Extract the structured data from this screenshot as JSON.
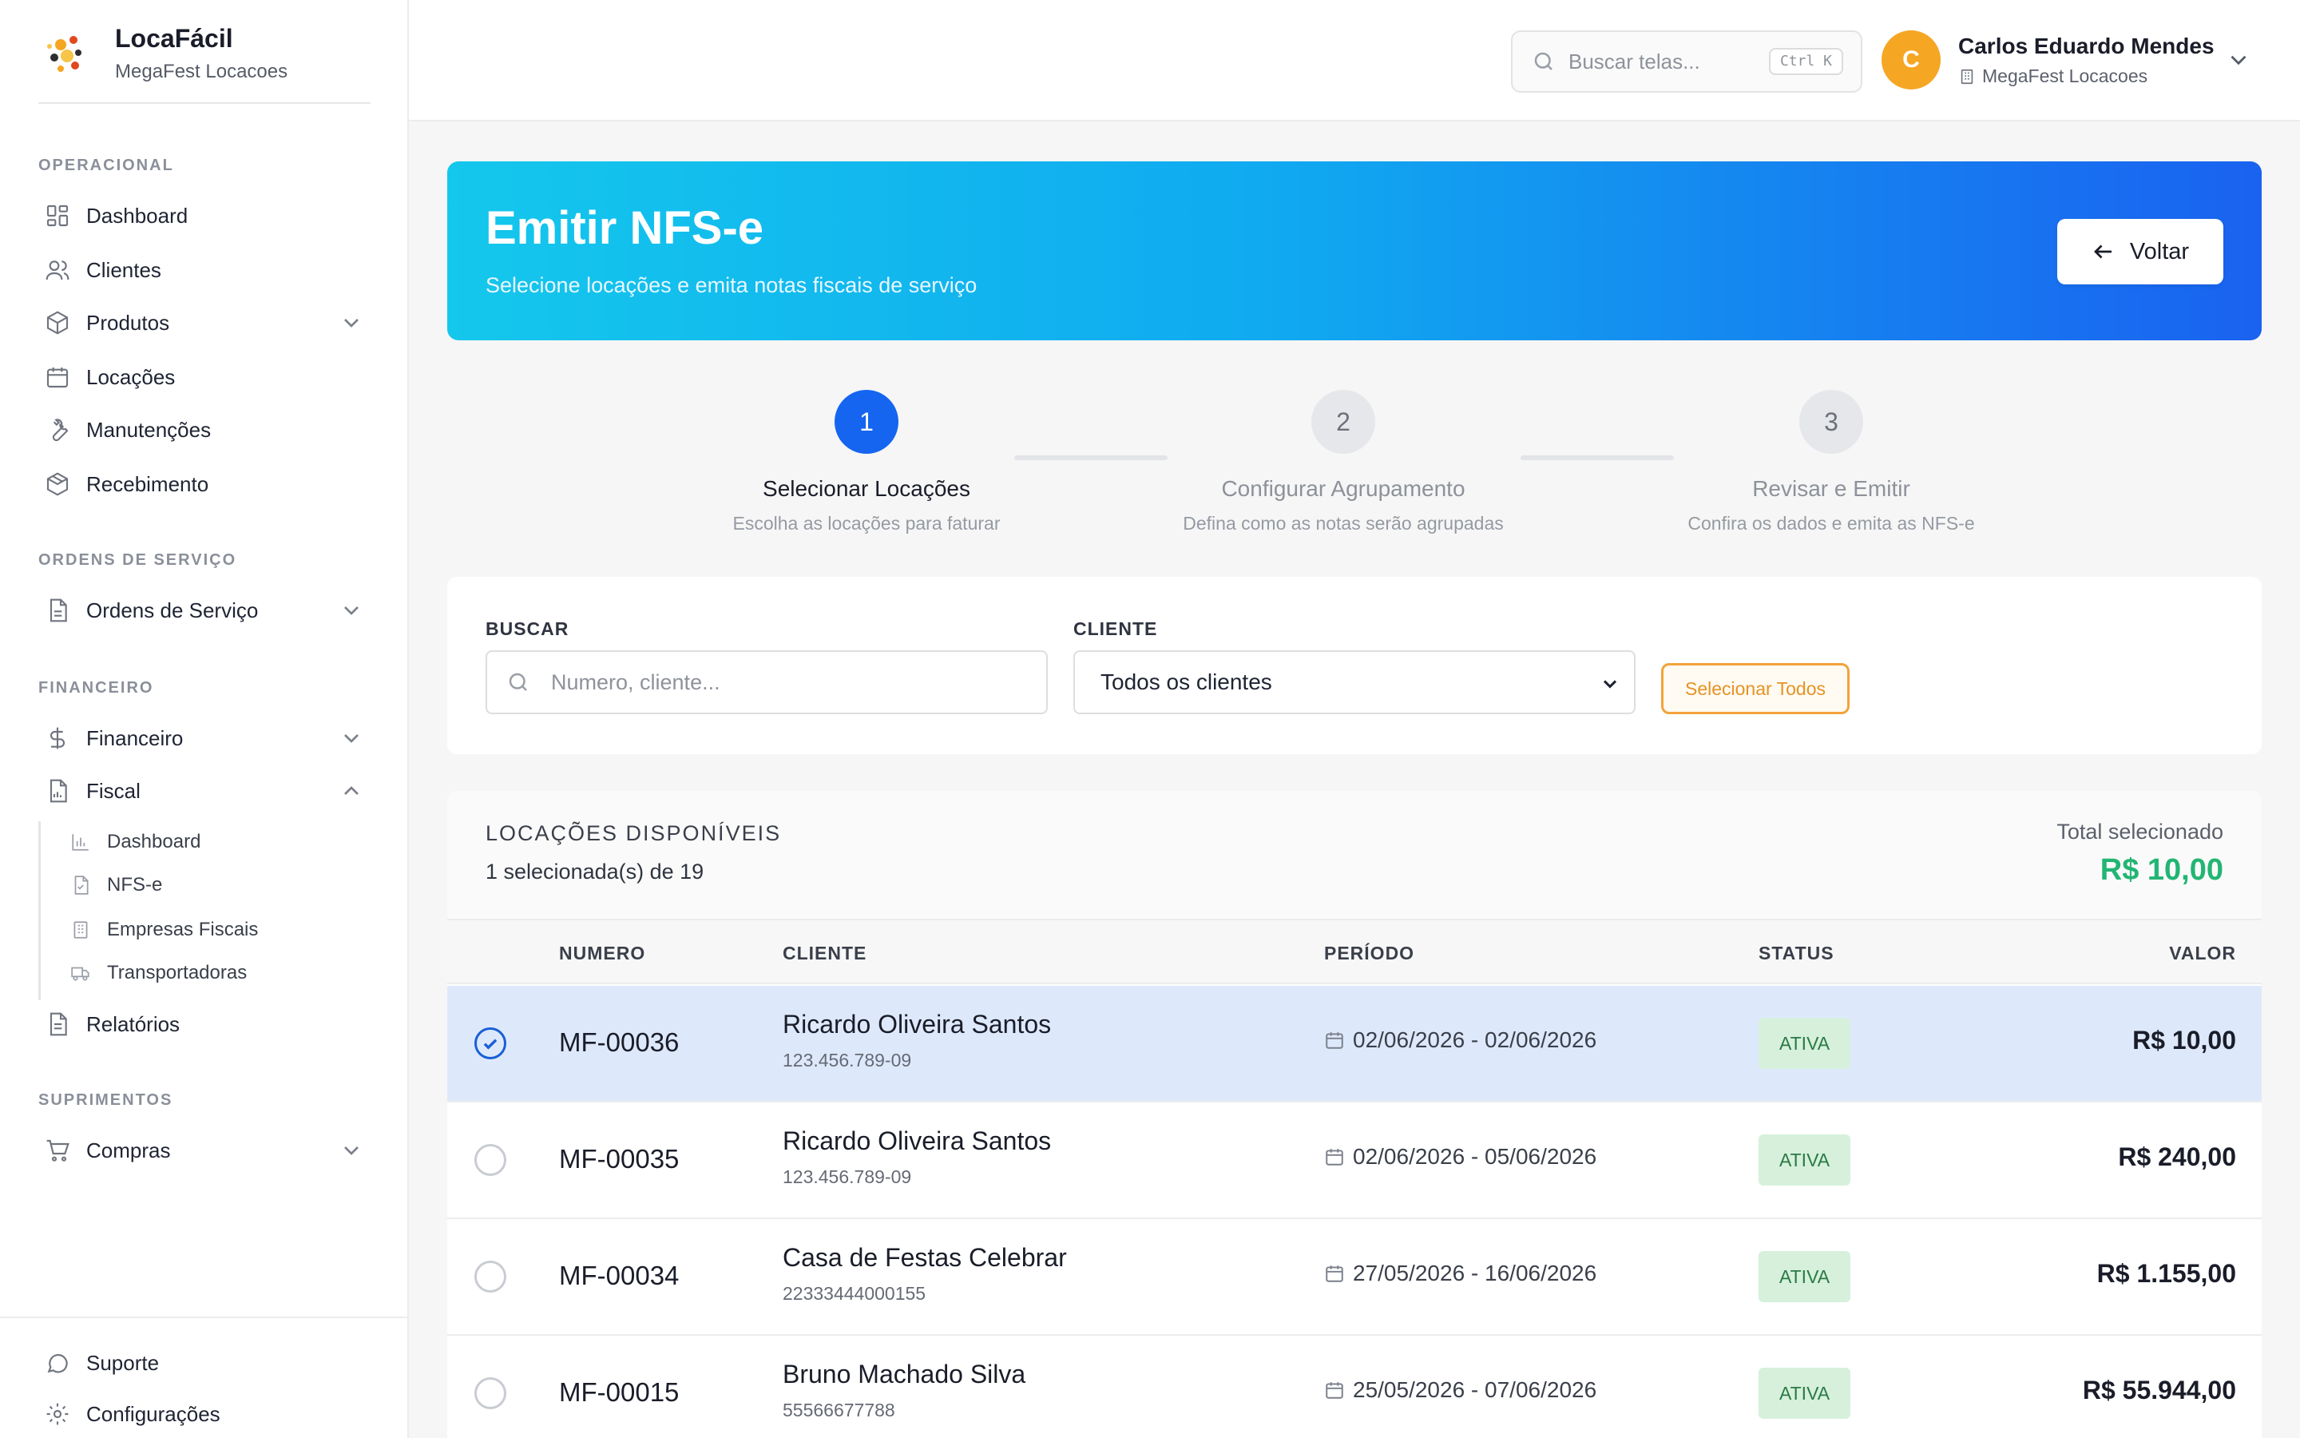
{
  "brand": {
    "name": "LocaFácil",
    "subtitle": "MegaFest Locacoes"
  },
  "sidebar": {
    "sections": {
      "operacional": "OPERACIONAL",
      "ordens": "ORDENS DE SERVIÇO",
      "financeiro": "FINANCEIRO",
      "suprimentos": "SUPRIMENTOS"
    },
    "items": {
      "dashboard": "Dashboard",
      "clientes": "Clientes",
      "produtos": "Produtos",
      "locacoes": "Locações",
      "manutencoes": "Manutenções",
      "recebimento": "Recebimento",
      "ordens_servico": "Ordens de Serviço",
      "financeiro": "Financeiro",
      "fiscal": "Fiscal",
      "relatorios": "Relatórios",
      "compras": "Compras"
    },
    "fiscal_sub": {
      "dashboard": "Dashboard",
      "nfse": "NFS-e",
      "empresas": "Empresas Fiscais",
      "transportadoras": "Transportadoras"
    },
    "footer": {
      "suporte": "Suporte",
      "configuracoes": "Configurações"
    }
  },
  "topbar": {
    "search_placeholder": "Buscar telas...",
    "shortcut": "Ctrl K",
    "user": {
      "initial": "C",
      "name": "Carlos Eduardo Mendes",
      "org": "MegaFest Locacoes"
    }
  },
  "hero": {
    "title": "Emitir NFS-e",
    "subtitle": "Selecione locações e emita notas fiscais de serviço",
    "back_label": "Voltar"
  },
  "steps": [
    {
      "number": "1",
      "title": "Selecionar Locações",
      "desc": "Escolha as locações para faturar"
    },
    {
      "number": "2",
      "title": "Configurar Agrupamento",
      "desc": "Defina como as notas serão agrupadas"
    },
    {
      "number": "3",
      "title": "Revisar e Emitir",
      "desc": "Confira os dados e emita as NFS-e"
    }
  ],
  "filters": {
    "search_label": "BUSCAR",
    "search_placeholder": "Numero, cliente...",
    "client_label": "CLIENTE",
    "client_value": "Todos os clientes",
    "select_all": "Selecionar Todos"
  },
  "table": {
    "title": "LOCAÇÕES DISPONÍVEIS",
    "count": "1 selecionada(s) de 19",
    "total_label": "Total selecionado",
    "total_value": "R$ 10,00",
    "headers": {
      "numero": "NUMERO",
      "cliente": "CLIENTE",
      "periodo": "PERÍODO",
      "status": "STATUS",
      "valor": "VALOR"
    },
    "rows": [
      {
        "numero": "MF-00036",
        "cliente": "Ricardo Oliveira Santos",
        "doc": "123.456.789-09",
        "periodo": "02/06/2026 - 02/06/2026",
        "status": "ATIVA",
        "valor": "R$ 10,00"
      },
      {
        "numero": "MF-00035",
        "cliente": "Ricardo Oliveira Santos",
        "doc": "123.456.789-09",
        "periodo": "02/06/2026 - 05/06/2026",
        "status": "ATIVA",
        "valor": "R$ 240,00"
      },
      {
        "numero": "MF-00034",
        "cliente": "Casa de Festas Celebrar",
        "doc": "22333444000155",
        "periodo": "27/05/2026 - 16/06/2026",
        "status": "ATIVA",
        "valor": "R$ 1.155,00"
      },
      {
        "numero": "MF-00015",
        "cliente": "Bruno Machado Silva",
        "doc": "55566677788",
        "periodo": "25/05/2026 - 07/06/2026",
        "status": "ATIVA",
        "valor": "R$ 55.944,00"
      }
    ]
  },
  "colors": {
    "primary": "#1565f0",
    "accent": "#f5a623",
    "success": "#22b573",
    "selected_row": "#dde9fb"
  }
}
